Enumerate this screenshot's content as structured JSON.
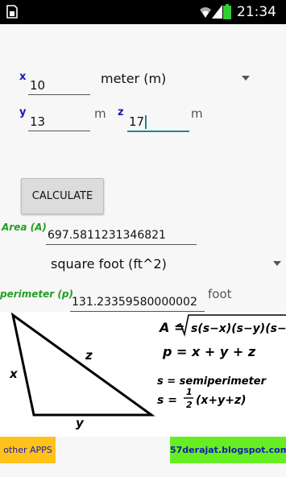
{
  "status_bar": {
    "time": "21:34"
  },
  "inputs": {
    "x": {
      "label": "x",
      "value": "10"
    },
    "y": {
      "label": "y",
      "value": "13",
      "unit": "m"
    },
    "z": {
      "label": "z",
      "value": "17",
      "unit": "m"
    },
    "length_unit": "meter (m)"
  },
  "calculate_label": "CALCULATE",
  "area": {
    "label": "Area (A)",
    "value": "697.5811231346821",
    "unit_select": "square foot (ft^2)"
  },
  "perimeter": {
    "label": "perimeter (p)",
    "value": "131.23359580000002",
    "unit": "foot"
  },
  "figure": {
    "side_x": "x",
    "side_y": "y",
    "side_z": "z",
    "formula_a_lhs": "A = ",
    "formula_a_rad": "s(s−x)(s−y)(s−z)",
    "formula_p": "p = x + y + z",
    "formula_s_def": "s = semiperimeter",
    "formula_s_lhs": "s = ",
    "formula_s_frac_num": "1",
    "formula_s_frac_den": "2",
    "formula_s_rhs": "(x+y+z)"
  },
  "footer": {
    "other_apps": "other APPS",
    "blog": "57derajat.blogspot.com"
  },
  "icons": [
    "sd-card-icon",
    "wifi-icon",
    "signal-icon",
    "battery-icon",
    "dropdown-caret-icon"
  ]
}
